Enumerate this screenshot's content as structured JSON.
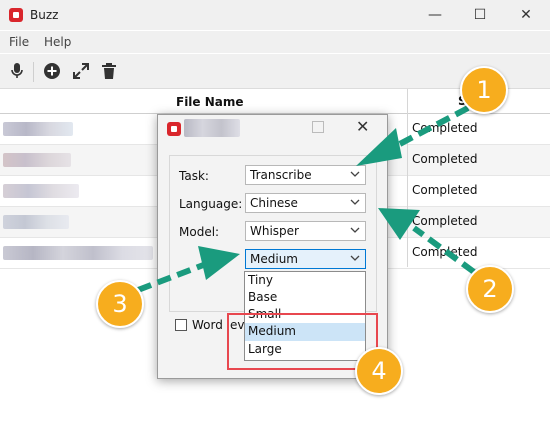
{
  "window": {
    "title": "Buzz",
    "controls": {
      "minimize": "—",
      "maximize": "☐",
      "close": "✕"
    }
  },
  "menu": {
    "file": "File",
    "help": "Help"
  },
  "toolbar": {
    "buttons": [
      {
        "icon": "microphone-icon"
      },
      {
        "icon": "add-circle-icon"
      },
      {
        "icon": "expand-icon"
      },
      {
        "icon": "trash-icon"
      }
    ]
  },
  "table": {
    "headers": {
      "file_name": "File Name",
      "status": "Status"
    },
    "rows": [
      {
        "status": "Completed"
      },
      {
        "status": "Completed"
      },
      {
        "status": "Completed"
      },
      {
        "status": "Completed"
      },
      {
        "status": "Completed"
      }
    ]
  },
  "dialog": {
    "fields": {
      "task": {
        "label": "Task:",
        "value": "Transcribe"
      },
      "language": {
        "label": "Language:",
        "value": "Chinese"
      },
      "model": {
        "label": "Model:",
        "value": "Whisper"
      },
      "size": {
        "value": "Medium"
      }
    },
    "dropdown_options": [
      "Tiny",
      "Base",
      "Small",
      "Medium",
      "Large"
    ],
    "selected_option": "Medium",
    "word_level_label": "Word lev"
  },
  "annotations": {
    "callouts": [
      "1",
      "2",
      "3",
      "4"
    ],
    "arrow_color": "#1a9b7e",
    "callout_color": "#f7ad1e",
    "highlight_color": "#e8474f"
  }
}
